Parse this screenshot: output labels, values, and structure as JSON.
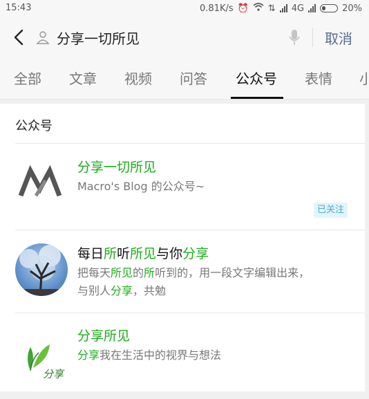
{
  "status_bar": {
    "time": "15:43",
    "network_speed": "0.81K/s",
    "network_type": "4G",
    "battery": "20%"
  },
  "search": {
    "query": "分享一切所见",
    "cancel_label": "取消"
  },
  "tabs": [
    {
      "label": "全部",
      "active": false
    },
    {
      "label": "文章",
      "active": false
    },
    {
      "label": "视频",
      "active": false
    },
    {
      "label": "问答",
      "active": false
    },
    {
      "label": "公众号",
      "active": true
    },
    {
      "label": "表情",
      "active": false
    },
    {
      "label": "小",
      "active": false
    }
  ],
  "section": {
    "title": "公众号"
  },
  "results": [
    {
      "avatar_icon": "macro-blog-logo-icon",
      "title": [
        {
          "text": "分享一切所见",
          "hl": true
        }
      ],
      "desc_lines": [
        [
          {
            "text": "Macro's Blog 的公众号~",
            "hl": false
          }
        ]
      ],
      "badge": "已关注"
    },
    {
      "avatar_icon": "tree-photo-avatar-icon",
      "title": [
        {
          "text": "每日",
          "hl": false
        },
        {
          "text": "所",
          "hl": true
        },
        {
          "text": "听",
          "hl": false
        },
        {
          "text": "所见",
          "hl": true
        },
        {
          "text": "与你",
          "hl": false
        },
        {
          "text": "分享",
          "hl": true
        }
      ],
      "desc_lines": [
        [
          {
            "text": "把每天",
            "hl": false
          },
          {
            "text": "所见",
            "hl": true
          },
          {
            "text": "的",
            "hl": false
          },
          {
            "text": "所",
            "hl": true
          },
          {
            "text": "听到的，用一段文字编辑出来，",
            "hl": false
          }
        ],
        [
          {
            "text": "与别人",
            "hl": false
          },
          {
            "text": "分享",
            "hl": true
          },
          {
            "text": "，共勉",
            "hl": false
          }
        ]
      ]
    },
    {
      "avatar_icon": "leaf-logo-icon",
      "avatar_text": "分享",
      "title": [
        {
          "text": "分享所见",
          "hl": true
        }
      ],
      "desc_lines": [
        [
          {
            "text": "分享",
            "hl": true
          },
          {
            "text": "我在生活中的视界与想法",
            "hl": false
          }
        ]
      ]
    }
  ],
  "colors": {
    "highlight": "#1aad19",
    "link": "#576b95",
    "badge_bg": "#e4f4fb",
    "badge_text": "#4aa9d6"
  }
}
